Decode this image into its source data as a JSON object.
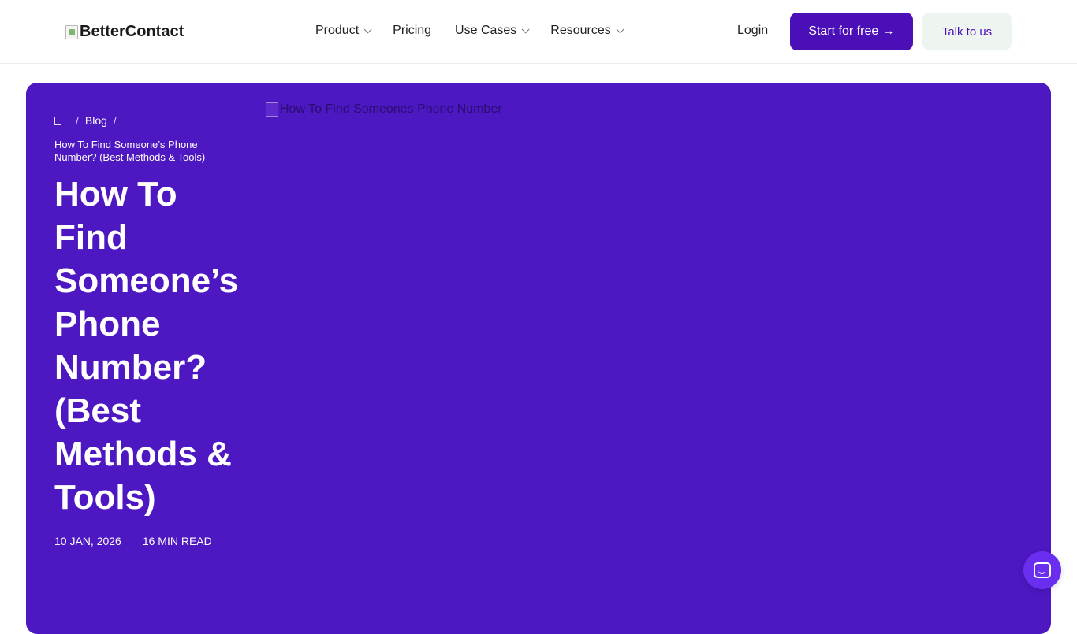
{
  "header": {
    "logo_text": "BetterContact",
    "nav": [
      {
        "label": "Product",
        "has_dropdown": true
      },
      {
        "label": "Pricing",
        "has_dropdown": false
      },
      {
        "label": "Use Cases",
        "has_dropdown": true
      },
      {
        "label": "Resources",
        "has_dropdown": true
      }
    ],
    "login_label": "Login",
    "start_label": "Start for free →",
    "talk_label": "Talk to us"
  },
  "hero": {
    "breadcrumb": {
      "home_icon": "home-icon",
      "blog_label": "Blog",
      "current": "How To Find Someone’s Phone Number? (Best Methods & Tools)"
    },
    "title": "How To Find Someone’s Phone Number? (Best Methods & Tools)",
    "date": "10 JAN, 2026",
    "read_time": "16 MIN READ",
    "image_alt": "How To Find Someones Phone Number"
  },
  "colors": {
    "accent": "#4b0fb8",
    "hero_bg": "#4d17c2",
    "talk_bg": "#eef4ef",
    "chat_bg": "#6a2ef0"
  },
  "chat_icon": "chat-icon"
}
